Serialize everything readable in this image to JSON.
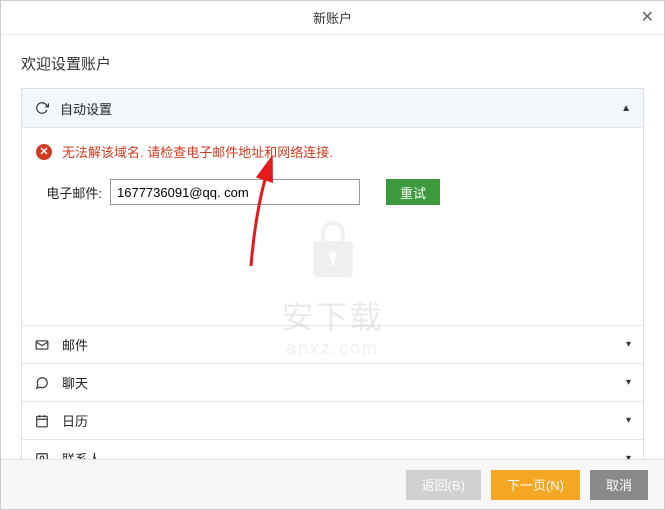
{
  "titlebar": {
    "title": "新账户"
  },
  "welcome": "欢迎设置账户",
  "auto_setup": {
    "title": "自动设置",
    "error": "无法解该域名. 请检查电子邮件地址和网络连接.",
    "email_label": "电子邮件:",
    "email_value": "1677736091@qq. com",
    "retry": "重试"
  },
  "sections": {
    "mail": "邮件",
    "chat": "聊天",
    "calendar": "日历",
    "contacts": "联系人"
  },
  "footer": {
    "back": "返回(B)",
    "next": "下一页(N)",
    "cancel": "取消"
  },
  "watermark": {
    "text1": "安下载",
    "text2": "anxz.com"
  }
}
